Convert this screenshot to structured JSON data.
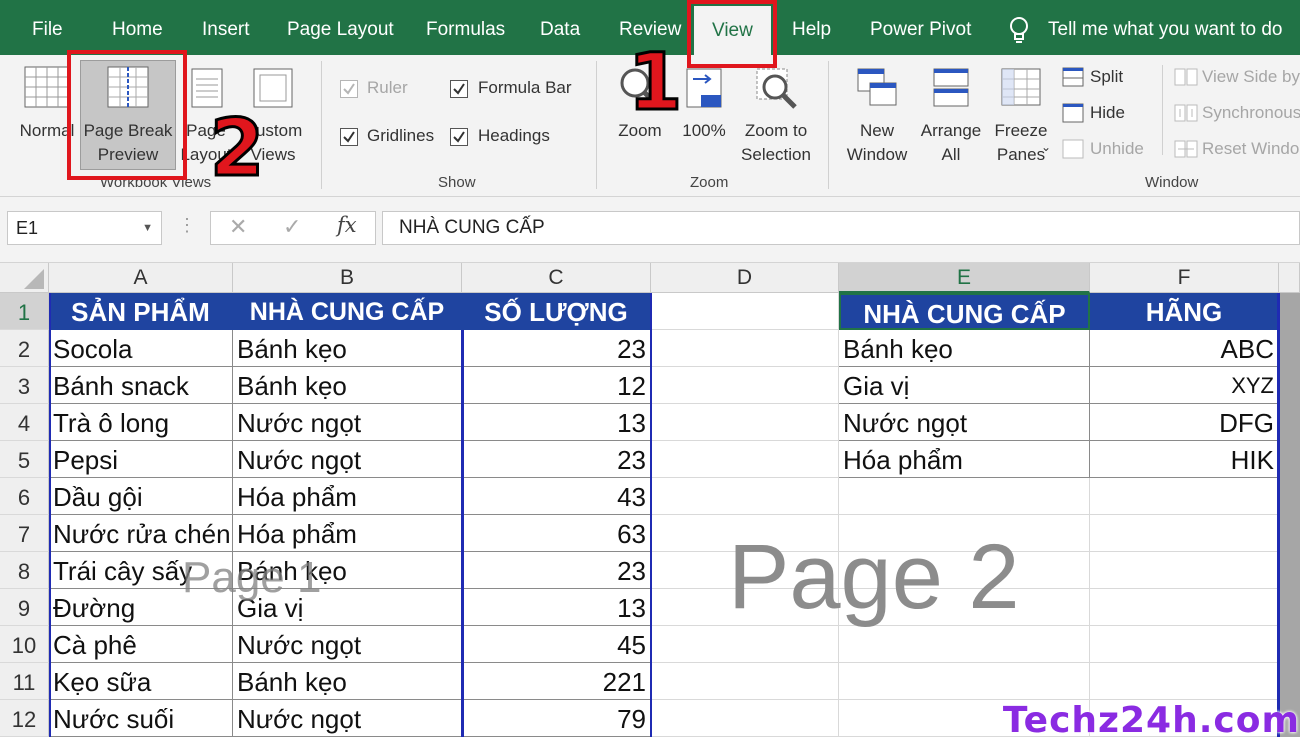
{
  "ribbon": {
    "tabs": [
      "File",
      "Home",
      "Insert",
      "Page Layout",
      "Formulas",
      "Data",
      "Review",
      "View",
      "Help",
      "Power Pivot"
    ],
    "active_tab": "View",
    "tell_me": "Tell me what you want to do",
    "workbook_views": {
      "normal": "Normal",
      "page_break_preview": [
        "Page Break",
        "Preview"
      ],
      "page_layout": [
        "Page",
        "Layout"
      ],
      "custom_views": [
        "Custom",
        "Views"
      ],
      "group_label": "Workbook Views"
    },
    "show": {
      "ruler": "Ruler",
      "formula_bar": "Formula Bar",
      "gridlines": "Gridlines",
      "headings": "Headings",
      "group_label": "Show"
    },
    "zoom": {
      "zoom": "Zoom",
      "hundred": "100%",
      "zoom_selection": [
        "Zoom to",
        "Selection"
      ],
      "group_label": "Zoom"
    },
    "window": {
      "new_window": [
        "New",
        "Window"
      ],
      "arrange_all": [
        "Arrange",
        "All"
      ],
      "freeze_panes": [
        "Freeze",
        "Panes"
      ],
      "split": "Split",
      "hide": "Hide",
      "unhide": "Unhide",
      "view_side": "View Side by",
      "synchronous": "Synchronous",
      "reset_window": "Reset Windo",
      "group_label": "Window"
    }
  },
  "formula_bar": {
    "name_box": "E1",
    "fx": "fx",
    "content": "NHÀ CUNG CẤP"
  },
  "sheet": {
    "columns": [
      "A",
      "B",
      "C",
      "D",
      "E",
      "F"
    ],
    "rows": [
      "1",
      "2",
      "3",
      "4",
      "5",
      "6",
      "7",
      "8",
      "9",
      "10",
      "11",
      "12"
    ],
    "table1_headers": [
      "SẢN PHẨM",
      "NHÀ CUNG CẤP",
      "SỐ LƯỢNG"
    ],
    "table1_rows": [
      [
        "Socola",
        "Bánh kẹo",
        "23"
      ],
      [
        "Bánh snack",
        "Bánh kẹo",
        "12"
      ],
      [
        "Trà ô long",
        "Nước ngọt",
        "13"
      ],
      [
        "Pepsi",
        "Nước ngọt",
        "23"
      ],
      [
        "Dầu gội",
        "Hóa phẩm",
        "43"
      ],
      [
        "Nước rửa chén",
        "Hóa phẩm",
        "63"
      ],
      [
        "Trái cây sấy",
        "Bánh kẹo",
        "23"
      ],
      [
        "Đường",
        "Gia vị",
        "13"
      ],
      [
        "Cà phê",
        "Nước ngọt",
        "45"
      ],
      [
        "Kẹo sữa",
        "Bánh kẹo",
        "221"
      ],
      [
        "Nước suối",
        "Nước ngọt",
        "79"
      ]
    ],
    "table2_headers": [
      "NHÀ CUNG CẤP",
      "HÃNG"
    ],
    "table2_rows": [
      [
        "Bánh kẹo",
        "ABC"
      ],
      [
        "Gia vị",
        "XYZ"
      ],
      [
        "Nước ngọt",
        "DFG"
      ],
      [
        "Hóa phẩm",
        "HIK"
      ]
    ],
    "page1_label": "Page 1",
    "page2_label": "Page 2"
  },
  "annotations": {
    "step1": "1",
    "step2": "2"
  },
  "watermark": "Techz24h.com",
  "colors": {
    "excel_green": "#217346",
    "header_blue": "#1f44a0",
    "highlight_red": "#e0161d",
    "page_break_blue": "#1f2bb3"
  }
}
